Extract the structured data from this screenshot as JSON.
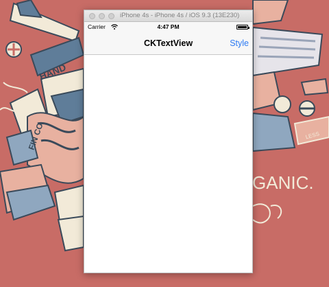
{
  "window": {
    "title": "iPhone 4s - iPhone 4s / iOS 9.3 (13E230)"
  },
  "status_bar": {
    "carrier": "Carrier",
    "time": "4:47 PM",
    "icons": [
      "wifi-icon",
      "battery-icon"
    ]
  },
  "nav_bar": {
    "title": "CKTextView",
    "right_button": "Style",
    "accent_color": "#2d7bf4"
  },
  "text_view": {
    "content": ""
  },
  "wallpaper": {
    "texts": [
      "HAND",
      "FIN CO.",
      "GANIC.",
      "LESS"
    ],
    "background_color": "#c86c66"
  }
}
